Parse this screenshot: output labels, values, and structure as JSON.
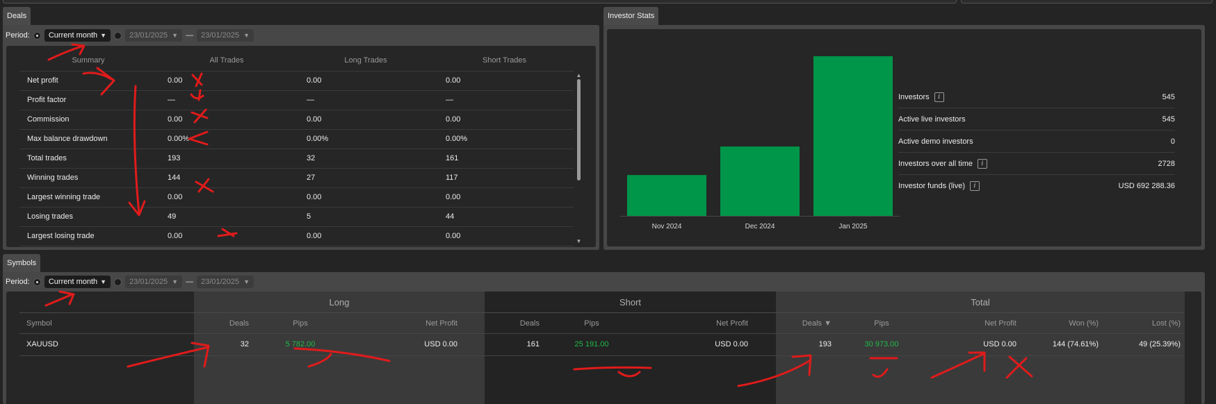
{
  "deals": {
    "tab_label": "Deals",
    "period": {
      "label": "Period:",
      "selected": "Current month",
      "date_from": "23/01/2025",
      "date_separator": "—",
      "date_to": "23/01/2025"
    },
    "table": {
      "headers": [
        "Summary",
        "All Trades",
        "Long Trades",
        "Short Trades"
      ],
      "rows": [
        [
          "Net profit",
          "0.00",
          "0.00",
          "0.00"
        ],
        [
          "Profit factor",
          "—",
          "—",
          "—"
        ],
        [
          "Commission",
          "0.00",
          "0.00",
          "0.00"
        ],
        [
          "Max balance drawdown",
          "0.00%",
          "0.00%",
          "0.00%"
        ],
        [
          "Total trades",
          "193",
          "32",
          "161"
        ],
        [
          "Winning trades",
          "144",
          "27",
          "117"
        ],
        [
          "Largest winning trade",
          "0.00",
          "0.00",
          "0.00"
        ],
        [
          "Losing trades",
          "49",
          "5",
          "44"
        ],
        [
          "Largest losing trade",
          "0.00",
          "0.00",
          "0.00"
        ]
      ]
    }
  },
  "investor_stats": {
    "tab_label": "Investor Stats",
    "stats": [
      {
        "label": "Investors",
        "value": "545",
        "info": true
      },
      {
        "label": "Active live investors",
        "value": "545",
        "info": false
      },
      {
        "label": "Active demo investors",
        "value": "0",
        "info": false
      },
      {
        "label": "Investors over all time",
        "value": "2728",
        "info": true
      },
      {
        "label": "Investor funds (live)",
        "value": "USD 692 288.36",
        "info": true
      }
    ],
    "info_glyph": "i"
  },
  "chart_data": {
    "type": "bar",
    "categories": [
      "Nov 2024",
      "Dec 2024",
      "Jan 2025"
    ],
    "values": [
      545,
      925,
      2130
    ],
    "ylim": [
      0,
      2130
    ],
    "grid": false,
    "bar_color": "#00964a"
  },
  "symbols": {
    "tab_label": "Symbols",
    "period": {
      "label": "Period:",
      "selected": "Current month",
      "date_from": "23/01/2025",
      "date_separator": "—",
      "date_to": "23/01/2025"
    },
    "groups": [
      "Long",
      "Short",
      "Total"
    ],
    "columns": [
      "Symbol",
      "Deals",
      "Pips",
      "Net Profit",
      "Deals",
      "Pips",
      "Net Profit",
      "Deals ▼",
      "Pips",
      "Net Profit",
      "Won (%)",
      "Lost (%)"
    ],
    "rows": [
      [
        "XAUUSD",
        "32",
        "5 782.00",
        "USD 0.00",
        "161",
        "25 191.00",
        "USD 0.00",
        "193",
        "30 973.00",
        "USD 0.00",
        "144 (74.61%)",
        "49 (25.39%)"
      ]
    ]
  },
  "colors": {
    "positive": "#1fba48",
    "bar": "#00964a",
    "annotation": "#e01b1b"
  },
  "icons": {
    "dropdown": "triangle-down-icon",
    "scroll_up": "scroll-up-icon",
    "scroll_down": "scroll-down-icon",
    "info": "info-icon"
  },
  "glyphs": {
    "caret": "▼",
    "scroll_up": "▲",
    "scroll_down": "▼"
  }
}
